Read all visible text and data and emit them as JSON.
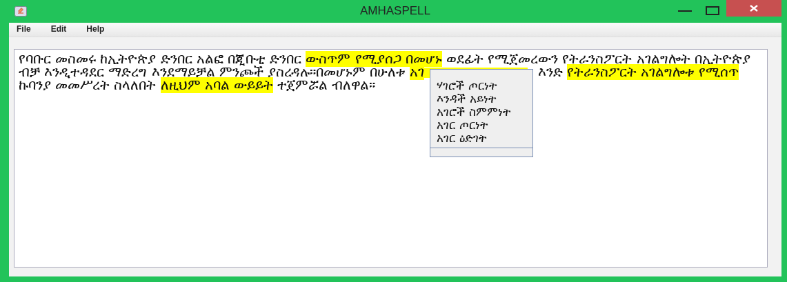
{
  "window": {
    "title": "AMHASPELL"
  },
  "menu": [
    "File",
    "Edit",
    "Help"
  ],
  "document": {
    "lines": [
      [
        {
          "text": "የባቡር መስመሩ ከኢትዮጵያ ድንበር አልፎ በጂቡቲ ድንበር ",
          "highlighted": false
        },
        {
          "text": "ውስጥም የሚያሰጋ በመሆኑ",
          "highlighted": true
        },
        {
          "text": " ወደፊት የሚጀመረውን የትራንስፖርት አገልግሎት በኢትዮጵያ",
          "highlighted": false
        }
      ],
      [
        {
          "text": "ብቻ እንዲተዳደር ማድረግ እንደማይቻል ምንጮች ያስረዳሉ።በመሆኑም በሁለቱ ",
          "highlighted": false
        },
        {
          "text": "አገ",
          "highlighted": true,
          "covered_after": true
        },
        {
          "text": " እንድ ",
          "highlighted": false
        },
        {
          "text": "የትራንስፖርት አገልግሎቱ የሚሰጥ",
          "highlighted": true
        }
      ],
      [
        {
          "text": "ኩባንያ መመሥረት ስላለበት ",
          "highlighted": false
        },
        {
          "text": "ለዚህም አባል ውይይት",
          "highlighted": true
        },
        {
          "text": " ተጀምሯል ብለዋል።",
          "highlighted": false
        }
      ]
    ]
  },
  "suggestions": [
    "ሃገሮች ጦርነት",
    "እንዳች አይነት",
    "አገሮች ስምምነት",
    "አገር ጦርነት",
    "አገር ዕድገት"
  ]
}
